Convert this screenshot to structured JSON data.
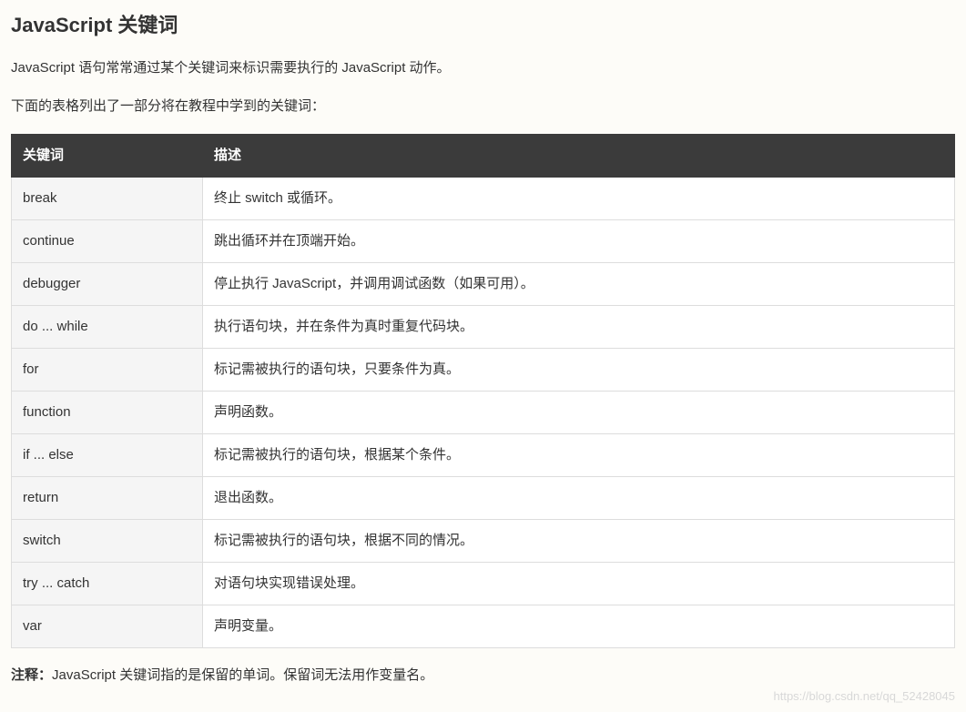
{
  "heading": "JavaScript 关键词",
  "intro1": "JavaScript 语句常常通过某个关键词来标识需要执行的 JavaScript 动作。",
  "intro2": "下面的表格列出了一部分将在教程中学到的关键词：",
  "table": {
    "headers": [
      "关键词",
      "描述"
    ],
    "rows": [
      {
        "keyword": "break",
        "description": "终止 switch 或循环。"
      },
      {
        "keyword": "continue",
        "description": "跳出循环并在顶端开始。"
      },
      {
        "keyword": "debugger",
        "description": "停止执行 JavaScript，并调用调试函数（如果可用）。"
      },
      {
        "keyword": "do ... while",
        "description": "执行语句块，并在条件为真时重复代码块。"
      },
      {
        "keyword": "for",
        "description": "标记需被执行的语句块，只要条件为真。"
      },
      {
        "keyword": "function",
        "description": "声明函数。"
      },
      {
        "keyword": "if ... else",
        "description": "标记需被执行的语句块，根据某个条件。"
      },
      {
        "keyword": "return",
        "description": "退出函数。"
      },
      {
        "keyword": "switch",
        "description": "标记需被执行的语句块，根据不同的情况。"
      },
      {
        "keyword": "try ... catch",
        "description": "对语句块实现错误处理。"
      },
      {
        "keyword": "var",
        "description": "声明变量。"
      }
    ]
  },
  "note": {
    "label": "注释：",
    "text": "JavaScript 关键词指的是保留的单词。保留词无法用作变量名。"
  },
  "watermark": "https://blog.csdn.net/qq_52428045"
}
